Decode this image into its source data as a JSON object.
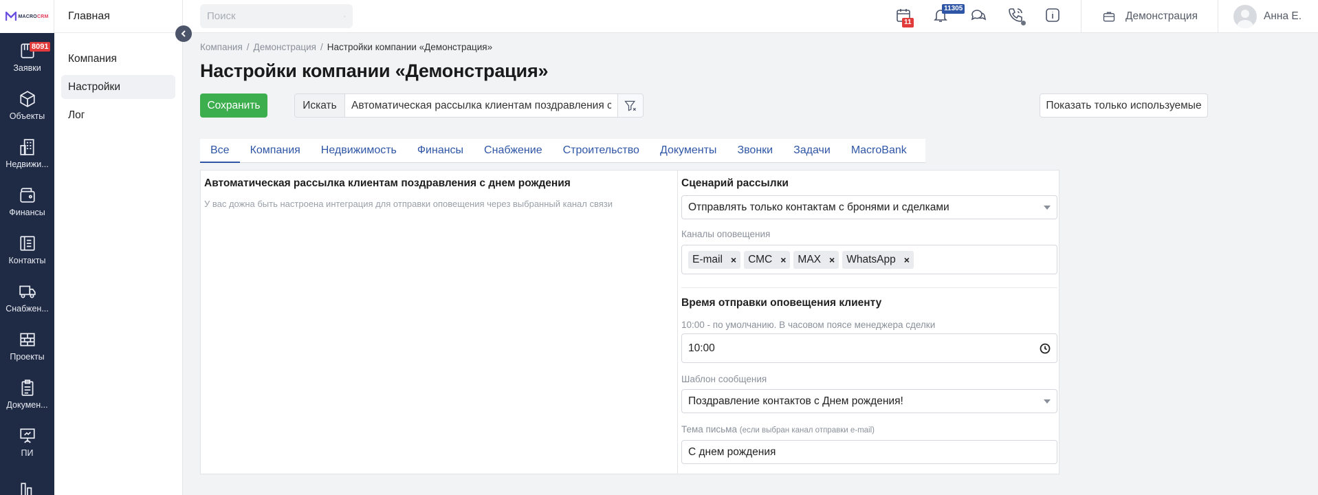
{
  "brand": {
    "name_a": "MACRO",
    "name_b": "CRM"
  },
  "rail": [
    {
      "label": "Заявки",
      "badge": "8091",
      "icon": "requests-icon"
    },
    {
      "label": "Объекты",
      "icon": "cube-icon"
    },
    {
      "label": "Недвижи...",
      "icon": "buildings-icon"
    },
    {
      "label": "Финансы",
      "icon": "wallet-icon"
    },
    {
      "label": "Контакты",
      "icon": "contacts-icon"
    },
    {
      "label": "Снабжен...",
      "icon": "truck-icon"
    },
    {
      "label": "Проекты",
      "icon": "projects-icon"
    },
    {
      "label": "Докумен...",
      "icon": "document-icon"
    },
    {
      "label": "ПИ",
      "icon": "presentation-icon"
    },
    {
      "label": "",
      "icon": "chart-icon"
    }
  ],
  "sidebar": {
    "header": "Главная",
    "items": [
      {
        "label": "Компания",
        "active": false
      },
      {
        "label": "Настройки",
        "active": true
      },
      {
        "label": "Лог",
        "active": false
      }
    ]
  },
  "topbar": {
    "search_placeholder": "Поиск",
    "calendar_count": "11",
    "notifications_count": "11305",
    "workspace": "Демонстрация",
    "user": "Анна Е."
  },
  "breadcrumb": {
    "items": [
      "Компания",
      "Демонстрация"
    ],
    "current": "Настройки компании «Демонстрация»",
    "separator": "/"
  },
  "page_title": "Настройки компании «Демонстрация»",
  "toolbar": {
    "save_label": "Сохранить",
    "search_label": "Искать",
    "search_value": "Автоматическая рассылка клиентам поздравления с",
    "show_used_label": "Показать только используемые"
  },
  "tabs": [
    {
      "label": "Все",
      "active": true
    },
    {
      "label": "Компания"
    },
    {
      "label": "Недвижимость"
    },
    {
      "label": "Финансы"
    },
    {
      "label": "Снабжение"
    },
    {
      "label": "Строительство"
    },
    {
      "label": "Документы"
    },
    {
      "label": "Звонки"
    },
    {
      "label": "Задачи"
    },
    {
      "label": "MacroBank"
    }
  ],
  "setting": {
    "title": "Автоматическая рассылка клиентам поздравления с днем рождения",
    "description": "У вас дожна быть настроена интеграция для отправки оповещения через выбранный канал связи",
    "scenario_heading": "Сценарий рассылки",
    "scenario_value": "Отправлять только контактам с бронями и сделками",
    "channels_label": "Каналы оповещения",
    "channels": [
      "E-mail",
      "СМС",
      "MAX",
      "WhatsApp"
    ],
    "time_heading": "Время отправки оповещения клиенту",
    "time_hint": "10:00 - по умолчанию. В часовом поясе менеджера сделки",
    "time_value": "10:00",
    "template_label": "Шаблон сообщения",
    "template_value": "Поздравление контактов с Днем рождения!",
    "subject_label": "Тема письма",
    "subject_note": "(если выбран канал отправки e-mail)",
    "subject_value": "С днем рождения"
  },
  "colors": {
    "rail": "#1f2a44",
    "save": "#3cae4e",
    "tab_active": "#2f56a6",
    "badge": "#e23b3b",
    "notif_badge": "#2f56a6"
  }
}
